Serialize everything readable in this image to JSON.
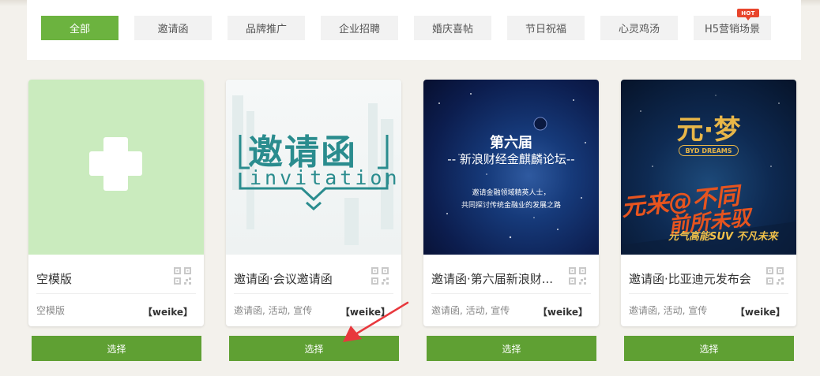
{
  "filters": [
    {
      "label": "全部",
      "active": true
    },
    {
      "label": "邀请函",
      "active": false
    },
    {
      "label": "品牌推广",
      "active": false
    },
    {
      "label": "企业招聘",
      "active": false
    },
    {
      "label": "婚庆喜帖",
      "active": false
    },
    {
      "label": "节日祝福",
      "active": false
    },
    {
      "label": "心灵鸡汤",
      "active": false
    },
    {
      "label": "H5营销场景",
      "active": false,
      "badge": "HOT"
    }
  ],
  "cards": [
    {
      "title": "空模版",
      "tags": "空模版",
      "author": "【weike】",
      "select_label": "选择"
    },
    {
      "title": "邀请函·会议邀请函",
      "tags": "邀请函, 活动, 宣传",
      "author": "【weike】",
      "select_label": "选择",
      "thumb": {
        "cn": "邀请函",
        "en": "invitation"
      }
    },
    {
      "title": "邀请函·第六届新浪财...",
      "tags": "邀请函, 活动, 宣传",
      "author": "【weike】",
      "select_label": "选择",
      "thumb": {
        "line1": "第六届",
        "line2": "-- 新浪财经金麒麟论坛--",
        "line3": "邀请金融领域精英人士，",
        "line4": "共同探讨传统金融业的发展之路"
      }
    },
    {
      "title": "邀请函·比亚迪元发布会",
      "tags": "邀请函, 活动, 宣传",
      "author": "【weike】",
      "select_label": "选择",
      "thumb": {
        "logo": "元·梦",
        "sub": "BYD DREAMS",
        "slogan1": "元来@不同",
        "slogan2": "前所未驭",
        "slogan3": "元气高能SUV 不凡未来"
      }
    }
  ],
  "colors": {
    "accent": "#6cb33f",
    "button": "#5fa033",
    "hot": "#e8452c",
    "annotation_arrow": "#e8383d"
  }
}
